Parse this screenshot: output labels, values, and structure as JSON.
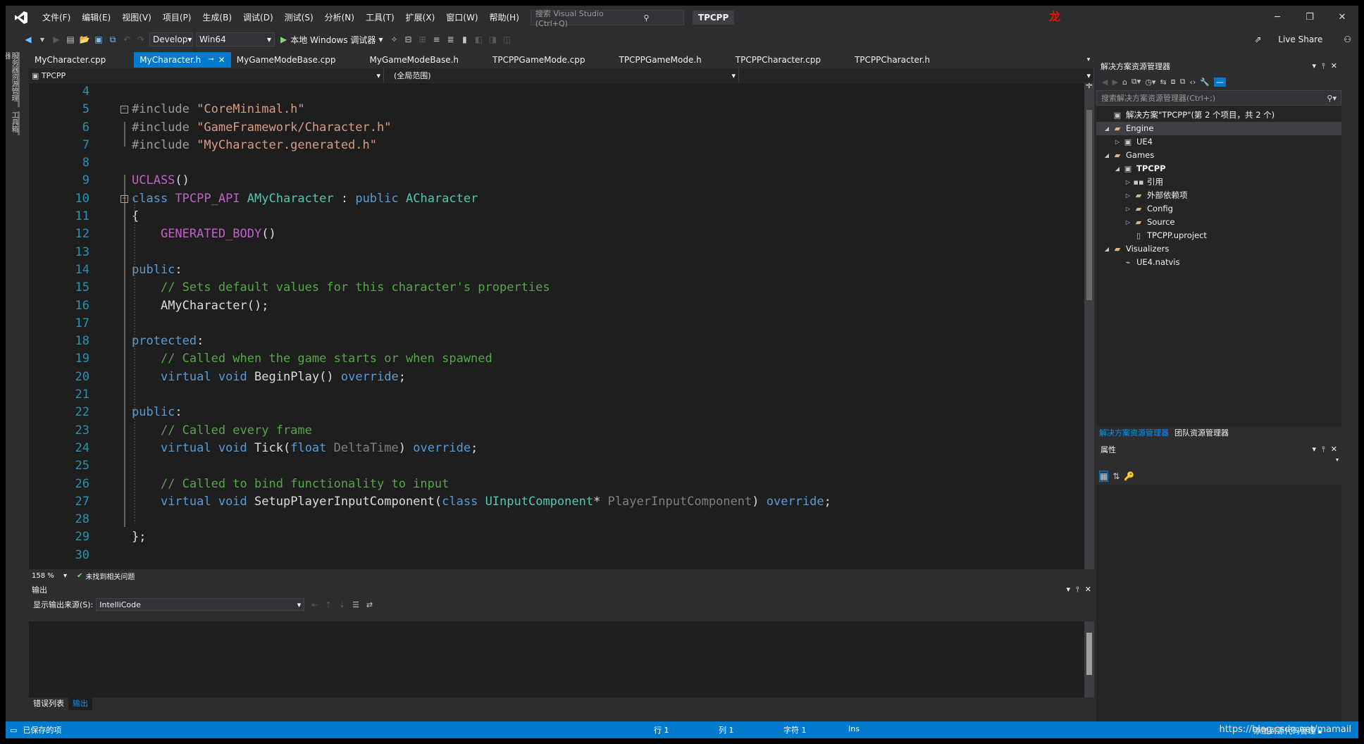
{
  "titlebar": {
    "menus": [
      "文件(F)",
      "编辑(E)",
      "视图(V)",
      "项目(P)",
      "生成(B)",
      "调试(D)",
      "测试(S)",
      "分析(N)",
      "工具(T)",
      "扩展(X)",
      "窗口(W)",
      "帮助(H)"
    ],
    "search_placeholder": "搜索 Visual Studio (Ctrl+Q)",
    "project_name": "TPCPP",
    "avatar_text": "龙",
    "window_buttons": [
      "─",
      "❐",
      "✕"
    ]
  },
  "toolbar": {
    "config": "Develop",
    "platform": "Win64",
    "run_label": "本地 Windows 调试器",
    "live_share": "Live Share"
  },
  "left_sidebar": {
    "tab1": "服务器资源管理器",
    "tab2": "工具箱"
  },
  "doc_tabs": [
    "MyCharacter.cpp",
    "MyCharacter.h",
    "MyGameModeBase.cpp",
    "MyGameModeBase.h",
    "TPCPPGameMode.cpp",
    "TPCPPGameMode.h",
    "TPCPPCharacter.cpp",
    "TPCPPCharacter.h"
  ],
  "active_tab_index": 1,
  "navbar": {
    "project": "TPCPP",
    "scope": "(全局范围)"
  },
  "editor": {
    "lines": [
      {
        "n": "4",
        "fold": "",
        "tokens": []
      },
      {
        "n": "5",
        "fold": "⊟",
        "tokens": [
          {
            "c": "pp",
            "t": "#include "
          },
          {
            "c": "str",
            "t": "\"CoreMinimal.h\""
          }
        ]
      },
      {
        "n": "6",
        "fold": "",
        "tokens": [
          {
            "c": "pp",
            "t": "#include "
          },
          {
            "c": "str",
            "t": "\"GameFramework/Character.h\""
          }
        ]
      },
      {
        "n": "7",
        "fold": "",
        "tokens": [
          {
            "c": "pp",
            "t": "#include "
          },
          {
            "c": "str",
            "t": "\"MyCharacter.generated.h\""
          }
        ]
      },
      {
        "n": "8",
        "fold": "",
        "tokens": []
      },
      {
        "n": "9",
        "fold": "",
        "tokens": [
          {
            "c": "mac",
            "t": "UCLASS"
          },
          {
            "c": "pl",
            "t": "()"
          }
        ]
      },
      {
        "n": "10",
        "fold": "⊟",
        "tokens": [
          {
            "c": "kw",
            "t": "class "
          },
          {
            "c": "mac",
            "t": "TPCPP_API "
          },
          {
            "c": "ty",
            "t": "AMyCharacter"
          },
          {
            "c": "pl",
            "t": " : "
          },
          {
            "c": "kw",
            "t": "public "
          },
          {
            "c": "ty",
            "t": "ACharacter"
          }
        ]
      },
      {
        "n": "11",
        "fold": "",
        "tokens": [
          {
            "c": "pl",
            "t": "{"
          }
        ]
      },
      {
        "n": "12",
        "fold": "",
        "tokens": [
          {
            "c": "pl",
            "t": "    "
          },
          {
            "c": "mac",
            "t": "GENERATED_BODY"
          },
          {
            "c": "pl",
            "t": "()"
          }
        ]
      },
      {
        "n": "13",
        "fold": "",
        "tokens": []
      },
      {
        "n": "14",
        "fold": "",
        "tokens": [
          {
            "c": "kw",
            "t": "public"
          },
          {
            "c": "pl",
            "t": ":"
          }
        ]
      },
      {
        "n": "15",
        "fold": "",
        "tokens": [
          {
            "c": "pl",
            "t": "    "
          },
          {
            "c": "cm",
            "t": "// Sets default values for this character's properties"
          }
        ]
      },
      {
        "n": "16",
        "fold": "",
        "tokens": [
          {
            "c": "pl",
            "t": "    "
          },
          {
            "c": "fn",
            "t": "AMyCharacter"
          },
          {
            "c": "pl",
            "t": "();"
          }
        ]
      },
      {
        "n": "17",
        "fold": "",
        "tokens": []
      },
      {
        "n": "18",
        "fold": "",
        "tokens": [
          {
            "c": "kw",
            "t": "protected"
          },
          {
            "c": "pl",
            "t": ":"
          }
        ]
      },
      {
        "n": "19",
        "fold": "",
        "tokens": [
          {
            "c": "pl",
            "t": "    "
          },
          {
            "c": "cm",
            "t": "// Called when the game starts or when spawned"
          }
        ]
      },
      {
        "n": "20",
        "fold": "",
        "tokens": [
          {
            "c": "pl",
            "t": "    "
          },
          {
            "c": "kw",
            "t": "virtual void "
          },
          {
            "c": "fn",
            "t": "BeginPlay"
          },
          {
            "c": "pl",
            "t": "() "
          },
          {
            "c": "kw",
            "t": "override"
          },
          {
            "c": "pl",
            "t": ";"
          }
        ]
      },
      {
        "n": "21",
        "fold": "",
        "tokens": []
      },
      {
        "n": "22",
        "fold": "",
        "tokens": [
          {
            "c": "kw",
            "t": "public"
          },
          {
            "c": "pl",
            "t": ":"
          }
        ]
      },
      {
        "n": "23",
        "fold": "",
        "tokens": [
          {
            "c": "pl",
            "t": "    "
          },
          {
            "c": "cm",
            "t": "// Called every frame"
          }
        ]
      },
      {
        "n": "24",
        "fold": "",
        "tokens": [
          {
            "c": "pl",
            "t": "    "
          },
          {
            "c": "kw",
            "t": "virtual void "
          },
          {
            "c": "fn",
            "t": "Tick"
          },
          {
            "c": "pl",
            "t": "("
          },
          {
            "c": "kw",
            "t": "float "
          },
          {
            "c": "par",
            "t": "DeltaTime"
          },
          {
            "c": "pl",
            "t": ") "
          },
          {
            "c": "kw",
            "t": "override"
          },
          {
            "c": "pl",
            "t": ";"
          }
        ]
      },
      {
        "n": "25",
        "fold": "",
        "tokens": []
      },
      {
        "n": "26",
        "fold": "",
        "tokens": [
          {
            "c": "pl",
            "t": "    "
          },
          {
            "c": "cm",
            "t": "// Called to bind functionality to input"
          }
        ]
      },
      {
        "n": "27",
        "fold": "",
        "tokens": [
          {
            "c": "pl",
            "t": "    "
          },
          {
            "c": "kw",
            "t": "virtual void "
          },
          {
            "c": "fn",
            "t": "SetupPlayerInputComponent"
          },
          {
            "c": "pl",
            "t": "("
          },
          {
            "c": "kw",
            "t": "class "
          },
          {
            "c": "ty",
            "t": "UInputComponent"
          },
          {
            "c": "pl",
            "t": "* "
          },
          {
            "c": "par",
            "t": "PlayerInputComponent"
          },
          {
            "c": "pl",
            "t": ") "
          },
          {
            "c": "kw",
            "t": "override"
          },
          {
            "c": "pl",
            "t": ";"
          }
        ]
      },
      {
        "n": "28",
        "fold": "",
        "tokens": []
      },
      {
        "n": "29",
        "fold": "",
        "tokens": [
          {
            "c": "pl",
            "t": "};"
          }
        ]
      },
      {
        "n": "30",
        "fold": "",
        "tokens": []
      }
    ],
    "zoom": "158 %",
    "issues": "未找到相关问题"
  },
  "output": {
    "title": "输出",
    "source_label": "显示输出来源(S):",
    "source_value": "IntelliCode",
    "tabs": [
      "错误列表",
      "输出"
    ]
  },
  "solution_explorer": {
    "title": "解决方案资源管理器",
    "search_placeholder": "搜索解决方案资源管理器(Ctrl+;)",
    "tree": [
      {
        "label": "解决方案\"TPCPP\"(第 2 个项目，共 2 个)",
        "level": 0,
        "arrow": "",
        "icon": "▣",
        "icon_class": "proj-ico",
        "bold": false
      },
      {
        "label": "Engine",
        "level": 0,
        "arrow": "◢",
        "icon": "▰",
        "icon_class": "fold-ico",
        "bold": false
      },
      {
        "label": "UE4",
        "level": 1,
        "arrow": "▷",
        "icon": "▣",
        "icon_class": "proj-ico",
        "bold": false
      },
      {
        "label": "Games",
        "level": 0,
        "arrow": "◢",
        "icon": "▰",
        "icon_class": "fold-ico",
        "bold": false
      },
      {
        "label": "TPCPP",
        "level": 1,
        "arrow": "◢",
        "icon": "▣",
        "icon_class": "proj-ico",
        "bold": true
      },
      {
        "label": "引用",
        "level": 2,
        "arrow": "▷",
        "icon": "▪▪",
        "icon_class": "ref-ico",
        "bold": false
      },
      {
        "label": "外部依赖项",
        "level": 2,
        "arrow": "▷",
        "icon": "▰",
        "icon_class": "fold-ico",
        "bold": false
      },
      {
        "label": "Config",
        "level": 2,
        "arrow": "▷",
        "icon": "▰",
        "icon_class": "fold-ico",
        "bold": false
      },
      {
        "label": "Source",
        "level": 2,
        "arrow": "▷",
        "icon": "▰",
        "icon_class": "fold-ico",
        "bold": false
      },
      {
        "label": "TPCPP.uproject",
        "level": 2,
        "arrow": "",
        "icon": "▯",
        "icon_class": "file-ico",
        "bold": false
      },
      {
        "label": "Visualizers",
        "level": 0,
        "arrow": "◢",
        "icon": "▰",
        "icon_class": "fold-ico",
        "bold": false
      },
      {
        "label": "UE4.natvis",
        "level": 1,
        "arrow": "",
        "icon": "⌁",
        "icon_class": "file-ico",
        "bold": false
      }
    ],
    "tabs": [
      "解决方案资源管理器",
      "团队资源管理器"
    ]
  },
  "properties": {
    "title": "属性"
  },
  "statusbar": {
    "saved": "已保存的项",
    "line": "行 1",
    "col": "列 1",
    "char": "字符 1",
    "mode": "Ins",
    "add_source": "添加到源代码管理 ▴",
    "url": "https://blog.csdn.net/mamail"
  }
}
